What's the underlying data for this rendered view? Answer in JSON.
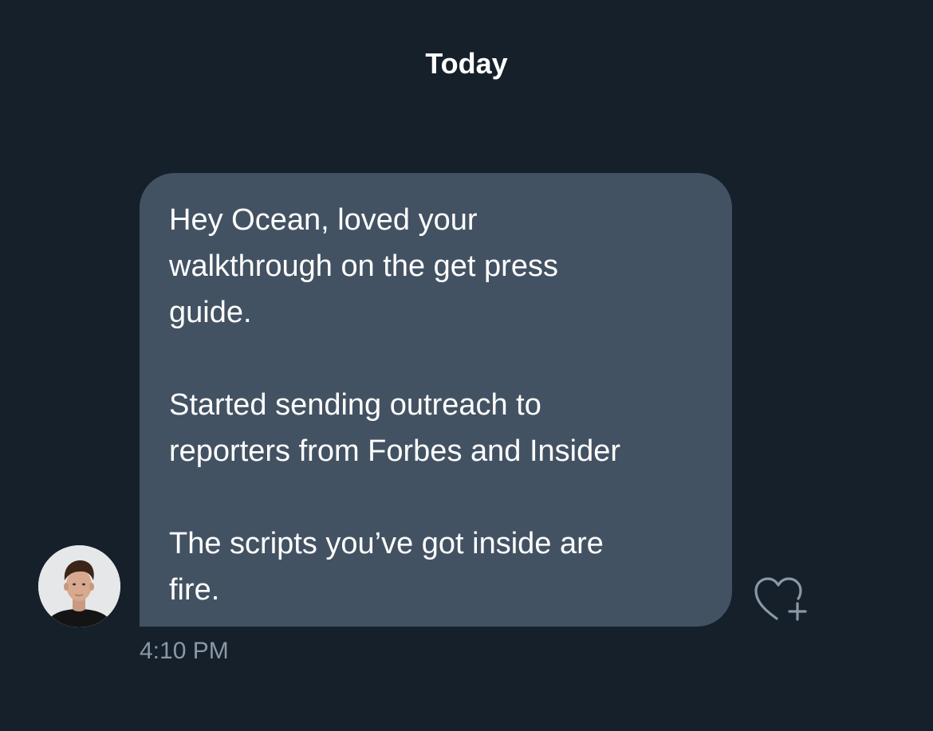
{
  "conversation": {
    "date_divider": "Today",
    "messages": [
      {
        "direction": "incoming",
        "lines": [
          "Hey Ocean, loved your",
          "walkthrough on the get press",
          "guide.",
          "",
          "Started sending outreach to",
          "reporters from Forbes and Insider",
          "",
          "The scripts you’ve got inside are",
          "fire."
        ],
        "timestamp": "4:10 PM",
        "avatar_icon": "profile-photo",
        "reaction_icon": "heart-plus-icon"
      }
    ]
  },
  "colors": {
    "background": "#15202b",
    "bubble": "#435262",
    "text": "#ffffff",
    "muted": "#8b98a5"
  }
}
